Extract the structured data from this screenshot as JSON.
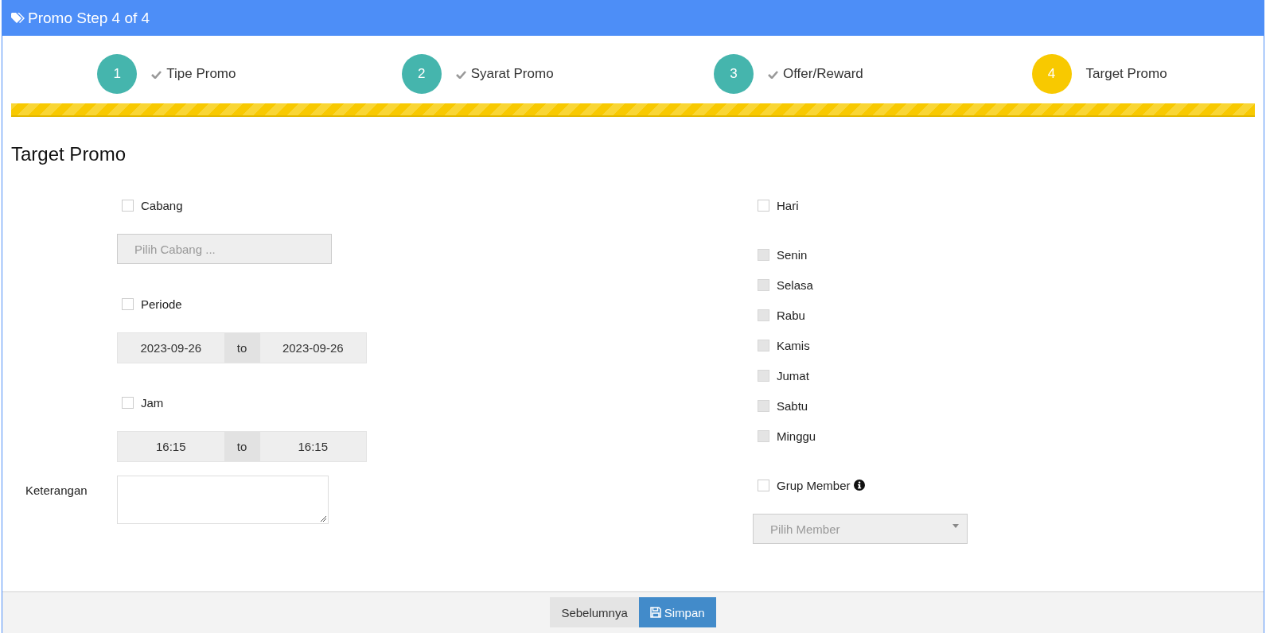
{
  "window": {
    "title": "Promo Step 4 of 4"
  },
  "steps": [
    {
      "number": "1",
      "label": "Tipe Promo",
      "completed": true,
      "selected": false
    },
    {
      "number": "2",
      "label": "Syarat Promo",
      "completed": true,
      "selected": false
    },
    {
      "number": "3",
      "label": "Offer/Reward",
      "completed": true,
      "selected": false
    },
    {
      "number": "4",
      "label": "Target Promo",
      "completed": false,
      "selected": true
    }
  ],
  "progress": {
    "level": 1
  },
  "section_title": "Target Promo",
  "left": {
    "cabang": {
      "label": "Cabang",
      "checked": false
    },
    "cabang_select": {
      "placeholder": "Pilih Cabang ...",
      "disabled": true
    },
    "periode": {
      "label": "Periode",
      "checked": false
    },
    "periode_range": {
      "from": "2023-09-26",
      "separator": "to",
      "to": "2023-09-26",
      "disabled": true
    },
    "jam": {
      "label": "Jam",
      "checked": false
    },
    "jam_range": {
      "from": "16:15",
      "separator": "to",
      "to": "16:15",
      "disabled": true
    },
    "keterangan": {
      "label": "Keterangan"
    }
  },
  "right": {
    "hari": {
      "label": "Hari",
      "checked": false
    },
    "days": [
      {
        "label": "Senin",
        "checked": false,
        "disabled": true
      },
      {
        "label": "Selasa",
        "checked": false,
        "disabled": true
      },
      {
        "label": "Rabu",
        "checked": false,
        "disabled": true
      },
      {
        "label": "Kamis",
        "checked": false,
        "disabled": true
      },
      {
        "label": "Jumat",
        "checked": false,
        "disabled": true
      },
      {
        "label": "Sabtu",
        "checked": false,
        "disabled": true
      },
      {
        "label": "Minggu",
        "checked": false,
        "disabled": true
      }
    ],
    "grup_member": {
      "label": "Grup Member",
      "checked": false
    },
    "member_select": {
      "placeholder": "Pilih Member",
      "disabled": true
    }
  },
  "buttons": [
    {
      "label": "Sebelumnya",
      "kind": "secondary"
    },
    {
      "label": "Simpan",
      "kind": "primary"
    }
  ]
}
